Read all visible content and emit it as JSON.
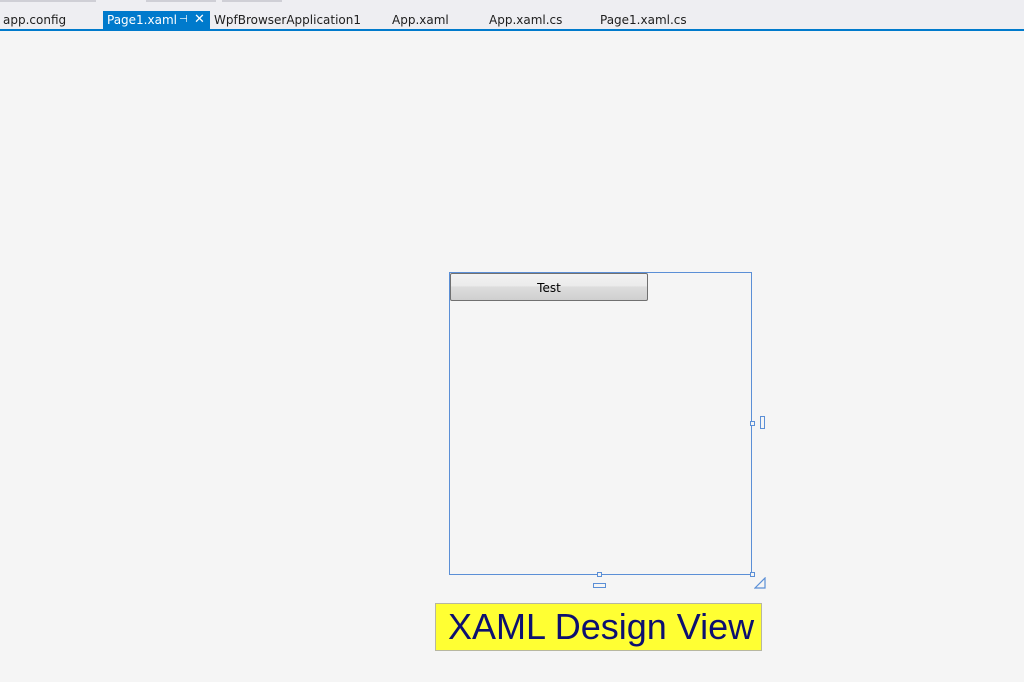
{
  "tabs": [
    {
      "label": "app.config",
      "active": false
    },
    {
      "label": "Page1.xaml",
      "active": true
    },
    {
      "label": "WpfBrowserApplication1",
      "active": false
    },
    {
      "label": "App.xaml",
      "active": false
    },
    {
      "label": "App.xaml.cs",
      "active": false
    },
    {
      "label": "Page1.xaml.cs",
      "active": false
    }
  ],
  "active_tab": {
    "pin_glyph": "⊣",
    "close_glyph": "✕"
  },
  "designer": {
    "button_label": "Test"
  },
  "caption": "XAML Design View",
  "colors": {
    "accent": "#007acc",
    "surface": "#f5f5f5",
    "selection": "#5b8fd6",
    "caption_bg": "#ffff33",
    "caption_text": "#0d1070"
  },
  "icons": {
    "pin": "pin-icon",
    "close": "close-icon",
    "resize": "resize-grip-icon"
  }
}
